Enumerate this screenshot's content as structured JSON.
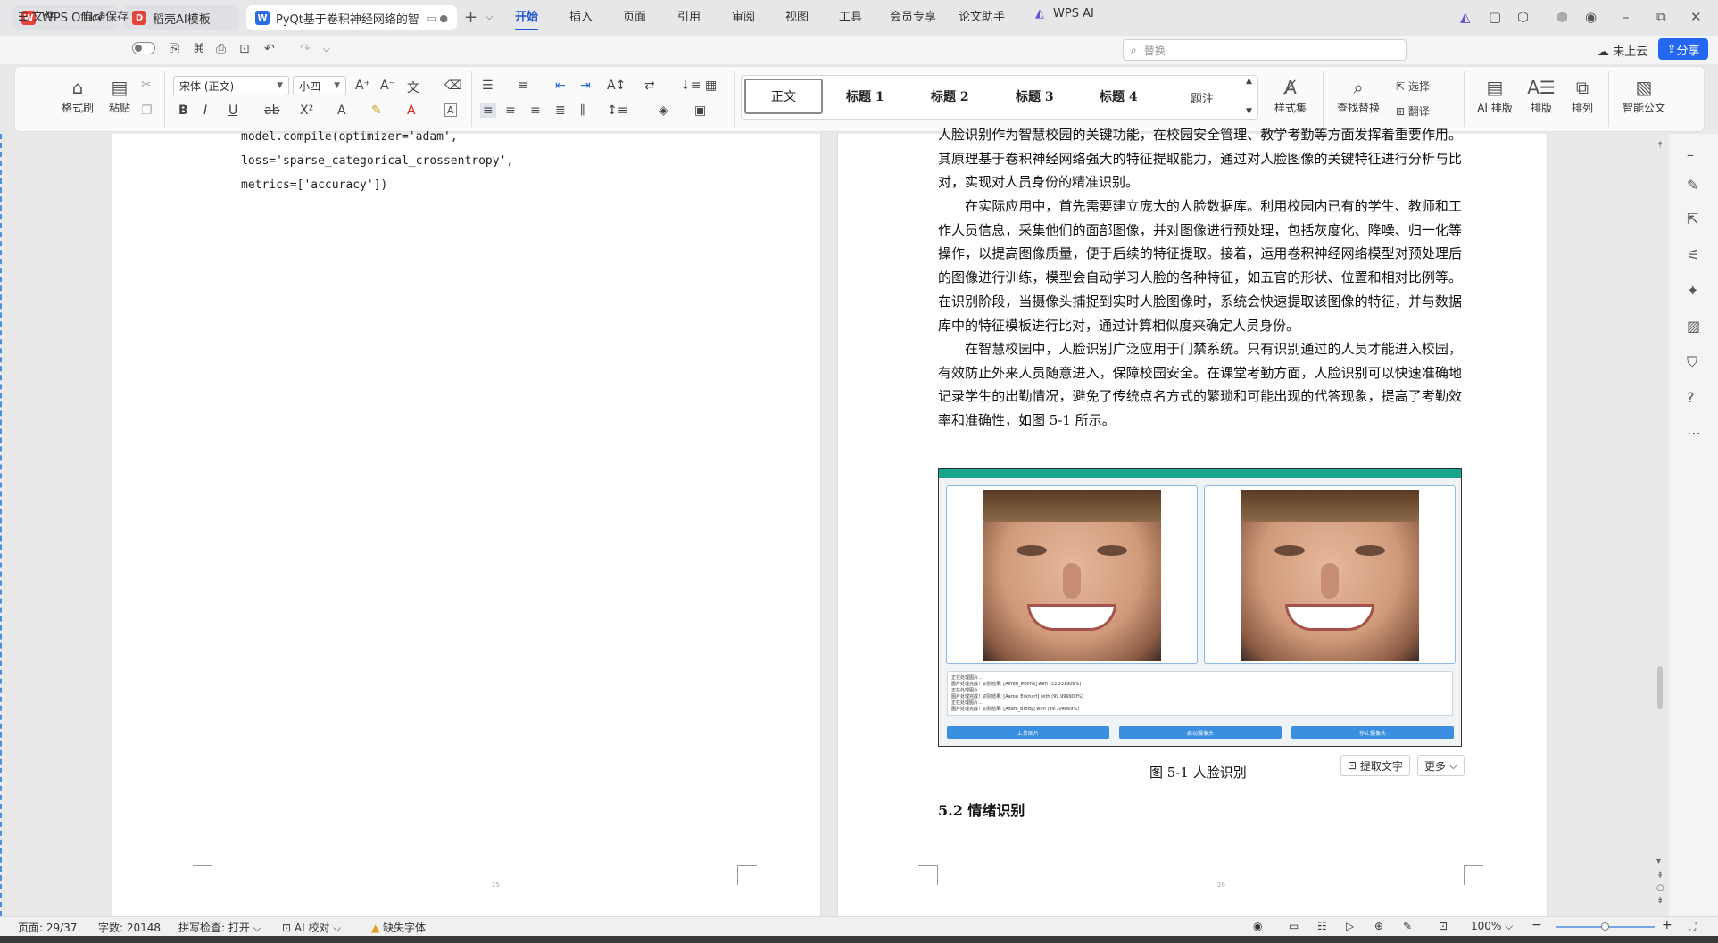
{
  "tabs": [
    {
      "label": "WPS Office"
    },
    {
      "label": "稻壳AI模板"
    },
    {
      "label": "PyQt基于卷积神经网络的智"
    }
  ],
  "menu": {
    "file": "文件",
    "autosave": "自动保存",
    "items": [
      "开始",
      "插入",
      "页面",
      "引用",
      "审阅",
      "视图",
      "工具",
      "会员专享",
      "论文助手",
      "WPS AI"
    ],
    "search_placeholder": "替换",
    "cloud": "未上云",
    "share": "分享"
  },
  "ribbon": {
    "format_painter": "格式刷",
    "paste": "粘贴",
    "font_name": "宋体 (正文)",
    "font_size": "小四",
    "styles": [
      "正文",
      "标题 1",
      "标题 2",
      "标题 3",
      "标题 4",
      "题注"
    ],
    "style_set": "样式集",
    "find_replace": "查找替换",
    "select": "选择",
    "translate": "翻译",
    "ai_layout": "AI 排版",
    "layout": "排版",
    "arrange": "排列",
    "smart_doc": "智能公文"
  },
  "left_page": {
    "code": [
      "model.compile(optimizer='adam',",
      "loss='sparse_categorical_crossentropy',",
      "metrics=['accuracy'])"
    ],
    "page_number": "25"
  },
  "right_page": {
    "paragraphs": [
      "人脸识别作为智慧校园的关键功能，在校园安全管理、教学考勤等方面发挥着重要作用。其原理基于卷积神经网络强大的特征提取能力，通过对人脸图像的关键特征进行分析与比对，实现对人员身份的精准识别。",
      "　　在实际应用中，首先需要建立庞大的人脸数据库。利用校园内已有的学生、教师和工作人员信息，采集他们的面部图像，并对图像进行预处理，包括灰度化、降噪、归一化等操作，以提高图像质量，便于后续的特征提取。接着，运用卷积神经网络模型对预处理后的图像进行训练，模型会自动学习人脸的各种特征，如五官的形状、位置和相对比例等。在识别阶段，当摄像头捕捉到实时人脸图像时，系统会快速提取该图像的特征，并与数据库中的特征模板进行比对，通过计算相似度来确定人员身份。",
      "　　在智慧校园中，人脸识别广泛应用于门禁系统。只有识别通过的人员才能进入校园，有效防止外来人员随意进入，保障校园安全。在课堂考勤方面，人脸识别可以快速准确地记录学生的出勤情况，避免了传统点名方式的繁琐和可能出现的代答现象，提高了考勤效率和准确性，如图 5-1 所示。"
    ],
    "figure_log": [
      "正在处理图片...",
      "图片处理完成！识别结果: [Alfred_Molina] with (33.331906%)",
      "正在处理图片...",
      "图片处理完成！识别结果: [Aaron_Eckhart] with (99.999900%)",
      "正在处理图片...",
      "图片处理完成！识别结果: [Adam_Brody] with (99.704869%)"
    ],
    "figure_buttons": [
      "上传图片",
      "启动摄像头",
      "停止摄像头"
    ],
    "caption": "图 5-1  人脸识别",
    "extract_text": "提取文字",
    "more": "更多",
    "heading": "5.2  情绪识别",
    "page_number": "26"
  },
  "status": {
    "page": "页面: 29/37",
    "words": "字数: 20148",
    "spell": "拼写检查: 打开",
    "ai_check": "AI 校对",
    "missing_font": "缺失字体",
    "zoom": "100%"
  }
}
